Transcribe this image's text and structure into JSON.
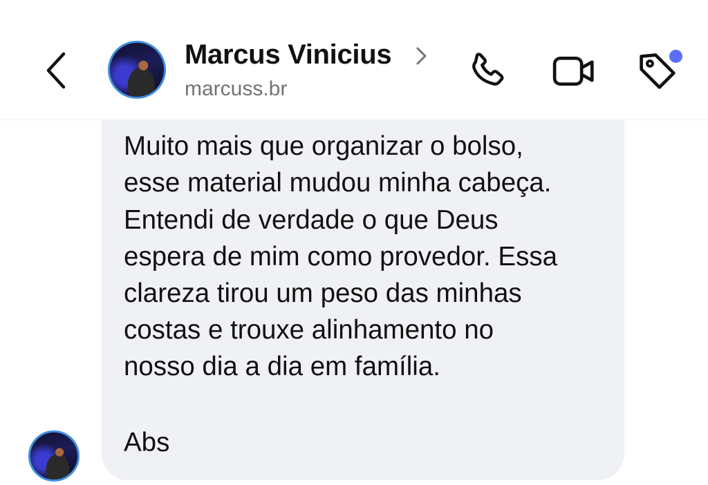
{
  "header": {
    "contact_name": "Marcus Vinicius",
    "username": "marcuss.br",
    "icons": {
      "back": "chevron-left-icon",
      "name_chevron": "chevron-right-icon",
      "call": "phone-icon",
      "video": "video-camera-icon",
      "tag": "tag-icon"
    },
    "notification_dot_color": "#5b6df8"
  },
  "message": {
    "paragraph1": "Muito mais que organizar o bolso,\nesse material mudou minha cabeça.",
    "paragraph2": "Entendi de verdade o que Deus\nespera de mim como provedor. Essa\nclareza tirou um peso das minhas\ncostas e trouxe alinhamento no\nnosso dia a dia em família.",
    "paragraph3": "Abs"
  },
  "colors": {
    "bubble_background": "#eff1f4",
    "avatar_ring": "#3e8ede",
    "text": "#111111",
    "secondary_text": "#737373"
  }
}
